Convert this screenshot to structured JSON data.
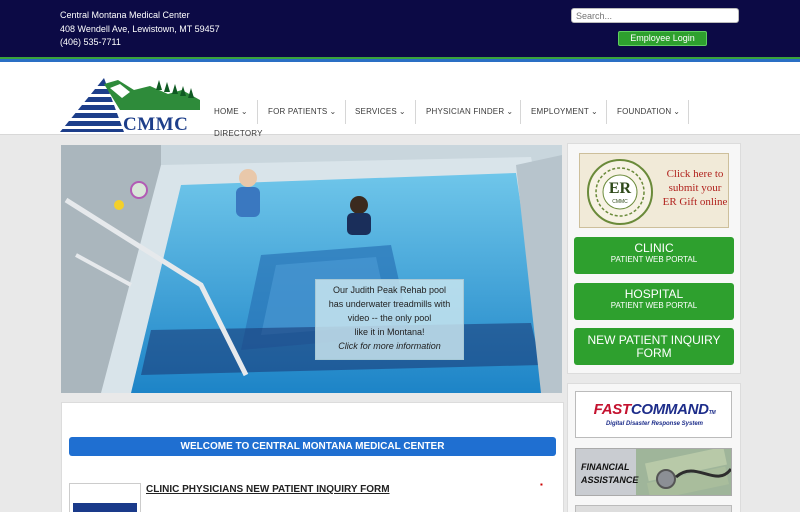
{
  "top": {
    "org_name": "Central Montana Medical Center",
    "address": "408 Wendell Ave, Lewistown, MT 59457",
    "phone": "(406) 535-7711",
    "search_placeholder": "Search...",
    "employee_login": "Employee Login"
  },
  "logo": {
    "text": "CMMC"
  },
  "nav": {
    "items": [
      {
        "label": "HOME"
      },
      {
        "label": "FOR PATIENTS"
      },
      {
        "label": "SERVICES"
      },
      {
        "label": "PHYSICIAN FINDER"
      },
      {
        "label": "EMPLOYMENT"
      },
      {
        "label": "FOUNDATION"
      }
    ],
    "directory": "DIRECTORY"
  },
  "hero": {
    "caption_lines": [
      "Our Judith Peak Rehab pool",
      "has underwater treadmills with",
      "video -- the only pool",
      "like it in Montana!"
    ],
    "caption_link": "Click for more information"
  },
  "main": {
    "welcome": "WELCOME TO CENTRAL MONTANA MEDICAL CENTER",
    "inquiry_link": "CLINIC PHYSICIANS NEW PATIENT INQUIRY FORM"
  },
  "sidebar": {
    "er_gift_lines": [
      "Click here to",
      "submit your",
      "ER Gift online"
    ],
    "er_badge": "ER",
    "er_badge_sub": "CMMC",
    "clinic": {
      "title": "CLINIC",
      "sub": "PATIENT WEB PORTAL"
    },
    "hospital": {
      "title": "HOSPITAL",
      "sub": "PATIENT WEB PORTAL"
    },
    "new_patient": {
      "line1": "NEW PATIENT INQUIRY",
      "line2": "FORM"
    },
    "fastcommand": {
      "fast": "FAST",
      "command": "COMMAND",
      "tm": "TM",
      "sub": "Digital Disaster Response System"
    },
    "financial": {
      "line1": "FINANCIAL",
      "line2": "ASSISTANCE"
    }
  },
  "colors": {
    "topbar": "#0c0a45",
    "accent_green": "#2ea02e",
    "accent_blue": "#1f6fd1",
    "logo_blue": "#1d3e8a"
  }
}
